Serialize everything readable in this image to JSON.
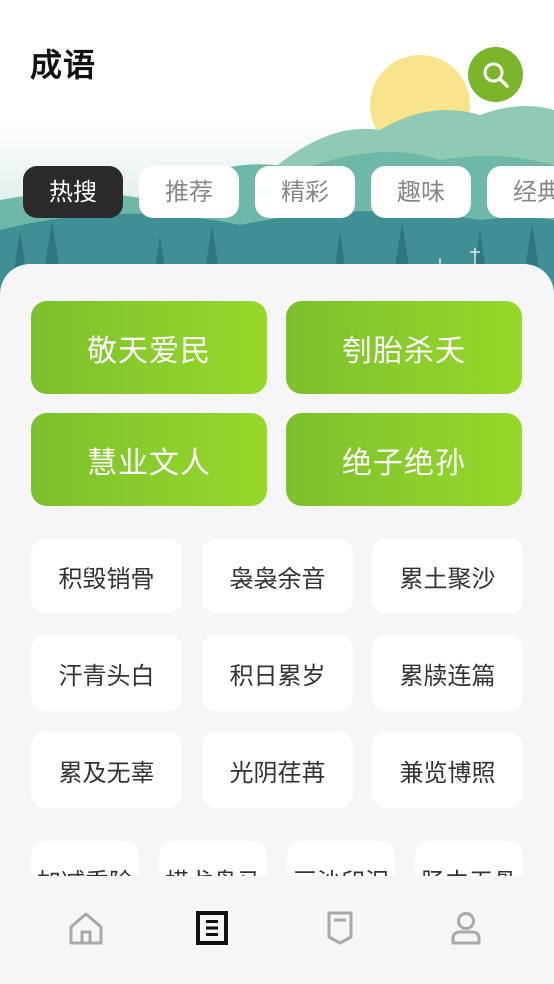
{
  "header": {
    "title": "成语"
  },
  "tabs": [
    {
      "label": "热搜",
      "active": true
    },
    {
      "label": "推荐",
      "active": false
    },
    {
      "label": "精彩",
      "active": false
    },
    {
      "label": "趣味",
      "active": false
    },
    {
      "label": "经典",
      "active": false
    }
  ],
  "featured": [
    "敬天爱民",
    "刳胎杀夭",
    "慧业文人",
    "绝子绝孙"
  ],
  "idioms": [
    "积毁销骨",
    "袅袅余音",
    "累土聚沙",
    "汗青头白",
    "积日累岁",
    "累牍连篇",
    "累及无辜",
    "光阴荏苒",
    "兼览博照"
  ],
  "idioms_partial": [
    "加减乘除",
    "横戈盘马",
    "画沙印泥",
    "肠中无骨"
  ],
  "nav": [
    {
      "icon": "home-icon",
      "active": false
    },
    {
      "icon": "idiom-book-icon",
      "active": true
    },
    {
      "icon": "bookmark-icon",
      "active": false
    },
    {
      "icon": "profile-icon",
      "active": false
    }
  ],
  "colors": {
    "accent": "#7bb52b",
    "active_tab": "#2a2a2a",
    "featured_gradient": [
      "#7cc02d",
      "#97d82a"
    ]
  }
}
